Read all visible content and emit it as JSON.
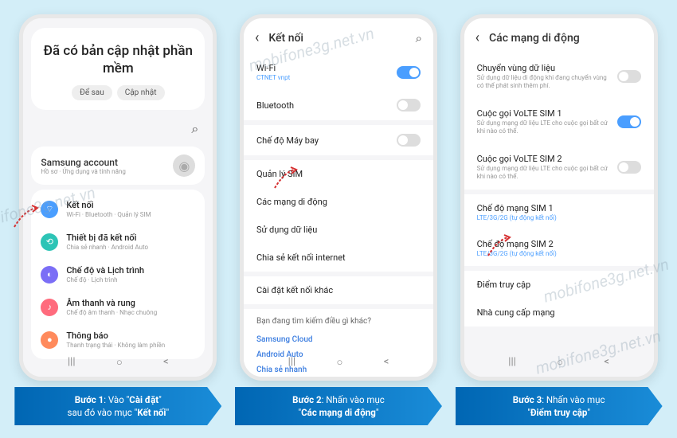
{
  "watermarks": [
    "mobifone3g.net.vn",
    "mobifone3g.net.vn",
    "mobifone3g.net.vn",
    "mobifone3g.net.vn"
  ],
  "phone1": {
    "update_title": "Đã có bản cập nhật phần mềm",
    "later": "Để sau",
    "now": "Cập nhật",
    "account_title": "Samsung account",
    "account_sub": "Hồ sơ · Ứng dụng và tính năng",
    "items": [
      {
        "title": "Kết nối",
        "sub": "Wi-Fi · Bluetooth · Quản lý SIM",
        "icon": "i-blue",
        "glyph": "⌔"
      },
      {
        "title": "Thiết bị đã kết nối",
        "sub": "Chia sẻ nhanh · Android Auto",
        "icon": "i-teal",
        "glyph": "⟲"
      },
      {
        "title": "Chế độ và Lịch trình",
        "sub": "Chế độ · Lịch trình",
        "icon": "i-purple",
        "glyph": "◐"
      },
      {
        "title": "Âm thanh và rung",
        "sub": "Chế độ âm thanh · Nhạc chuông",
        "icon": "i-red",
        "glyph": "♪"
      },
      {
        "title": "Thông báo",
        "sub": "Thanh trạng thái · Không làm phiền",
        "icon": "i-orange",
        "glyph": "●"
      }
    ]
  },
  "phone2": {
    "header": "Kết nối",
    "rows": [
      {
        "title": "Wi-Fi",
        "sub": "CTNET vnpt",
        "sub_color": "blue",
        "toggle": "on"
      },
      {
        "title": "Bluetooth",
        "toggle": "off"
      }
    ],
    "airplane": {
      "title": "Chế độ Máy bay",
      "toggle": "off"
    },
    "plain": [
      "Quản lý SIM",
      "Các mạng di động",
      "Sử dụng dữ liệu",
      "Chia sẻ kết nối internet"
    ],
    "other": "Cài đặt kết nối khác",
    "suggest_title": "Bạn đang tìm kiếm điều gì khác?",
    "suggest_links": [
      "Samsung Cloud",
      "Android Auto",
      "Chia sẻ nhanh"
    ]
  },
  "phone3": {
    "header": "Các mạng di động",
    "rows": [
      {
        "title": "Chuyển vùng dữ liệu",
        "sub": "Sử dụng dữ liệu di động khi đang chuyển vùng có thể phát sinh thêm phí.",
        "toggle": "off"
      },
      {
        "title": "Cuộc gọi VoLTE SIM 1",
        "sub": "Sử dụng mạng dữ liệu LTE cho cuộc gọi bất cứ khi nào có thể.",
        "toggle": "on"
      },
      {
        "title": "Cuộc gọi VoLTE SIM 2",
        "sub": "Sử dụng mạng dữ liệu LTE cho cuộc gọi bất cứ khi nào có thể.",
        "toggle": "off"
      }
    ],
    "mode1": {
      "title": "Chế độ mạng SIM 1",
      "sub": "LTE/3G/2G (tự động kết nối)"
    },
    "mode2": {
      "title": "Chế độ mạng SIM 2",
      "sub": "LTE/3G/2G (tự động kết nối)"
    },
    "apn": "Điểm truy cập",
    "carrier": "Nhà cung cấp mạng"
  },
  "captions": [
    {
      "bold1": "Bước 1",
      "text1": ": Vào \"",
      "bold2": "Cài đặt",
      "text2": "\"",
      "line2a": "sau đó vào mục \"",
      "line2b": "Kết nối",
      "line2c": "\""
    },
    {
      "bold1": "Bước 2",
      "text1": ": Nhấn vào mục",
      "line2a": "\"",
      "line2b": "Các mạng di động",
      "line2c": "\""
    },
    {
      "bold1": "Bước 3",
      "text1": ": Nhấn vào mục",
      "line2a": "\"",
      "line2b": "Điểm truy cập",
      "line2c": "\""
    }
  ]
}
